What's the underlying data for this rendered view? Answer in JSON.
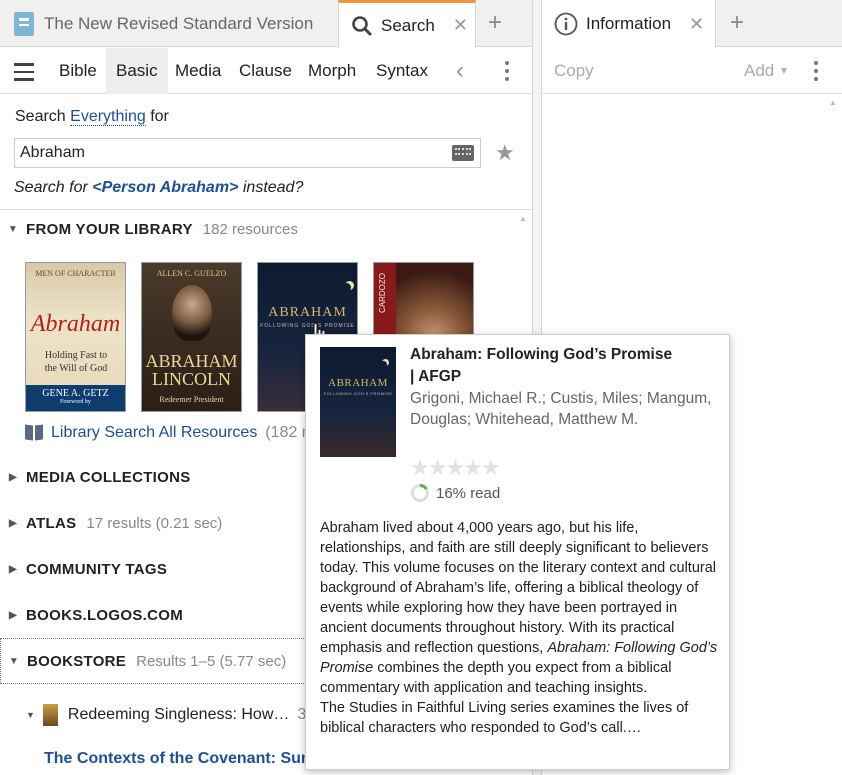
{
  "left_tabs": {
    "bible_tab": "The New Revised Standard Version",
    "search_tab": "Search"
  },
  "right_tabs": {
    "info_tab": "Information"
  },
  "search_toolbar": {
    "items": [
      "Bible",
      "Basic",
      "Media",
      "Clause",
      "Morph",
      "Syntax"
    ],
    "selected": "Basic"
  },
  "info_toolbar": {
    "copy_label": "Copy",
    "add_label": "Add"
  },
  "search": {
    "prefix": "Search",
    "scope": "Everything",
    "suffix": "for",
    "query": "Abraham",
    "suggestion_prefix": "Search for",
    "suggestion_link": "<Person Abraham>",
    "suggestion_suffix": "instead?"
  },
  "sections": {
    "library": {
      "title": "FROM YOUR LIBRARY",
      "count": "182 resources"
    },
    "library_search_link": "Library Search All Resources",
    "library_search_count": "(182 r",
    "media": {
      "title": "MEDIA COLLECTIONS"
    },
    "atlas": {
      "title": "ATLAS",
      "count": "17 results (0.21 sec)"
    },
    "community": {
      "title": "COMMUNITY TAGS"
    },
    "books": {
      "title": "BOOKS.LOGOS.COM"
    },
    "bookstore": {
      "title": "BOOKSTORE",
      "count": "Results 1–5 (5.77 sec)"
    }
  },
  "covers": [
    {
      "series": "MEN OF CHARACTER",
      "title": "Abraham",
      "subtitle": "Holding Fast to the Will of God",
      "author": "GENE A. GETZ",
      "foreword": "Foreword by"
    },
    {
      "author": "ALLEN C. GUELZO",
      "title_top": "ABRAHAM",
      "title_bottom": "LINCOLN",
      "subtitle": "Redeemer President"
    },
    {
      "title": "ABRAHAM",
      "subtitle": "FOLLOWING GOD'S PROMISE"
    },
    {
      "spine": "CARDOZO"
    }
  ],
  "bookstore_items": {
    "item1": "Redeeming Singleness: How…",
    "item1_count": "3",
    "item2": "The Contexts of the Covenant: Sum"
  },
  "popup": {
    "title": "Abraham: Following God’s Promise",
    "abbrev": "| AFGP",
    "authors": "Grigoni, Michael R.; Custis, Miles; Mangum, Douglas; Whitehead, Matthew M.",
    "rating": 0,
    "read_progress": 0.16,
    "read_label": "16% read",
    "desc_1": "Abraham lived about 4,000 years ago, but his life, relationships, and faith are still deeply significant to believers today. This volume focuses on the literary context and cultural background of Abraham’s life, offering a biblical theology of events while exploring how they have been portrayed in ancient documents throughout history. With its practical emphasis and reflection questions,",
    "desc_italic": "Abraham: Following God’s Promise",
    "desc_2": "combines the depth you expect from a biblical commentary with application and teaching insights.",
    "desc_3": "The Studies in Faithful Living series examines the lives of biblical characters who responded to God’s call.…",
    "cover_title": "ABRAHAM",
    "cover_subtitle": "FOLLOWING GOD'S PROMISE"
  },
  "colors": {
    "accent": "#f0933c",
    "link": "#1a4f9c",
    "progress": "#6aa84f"
  }
}
